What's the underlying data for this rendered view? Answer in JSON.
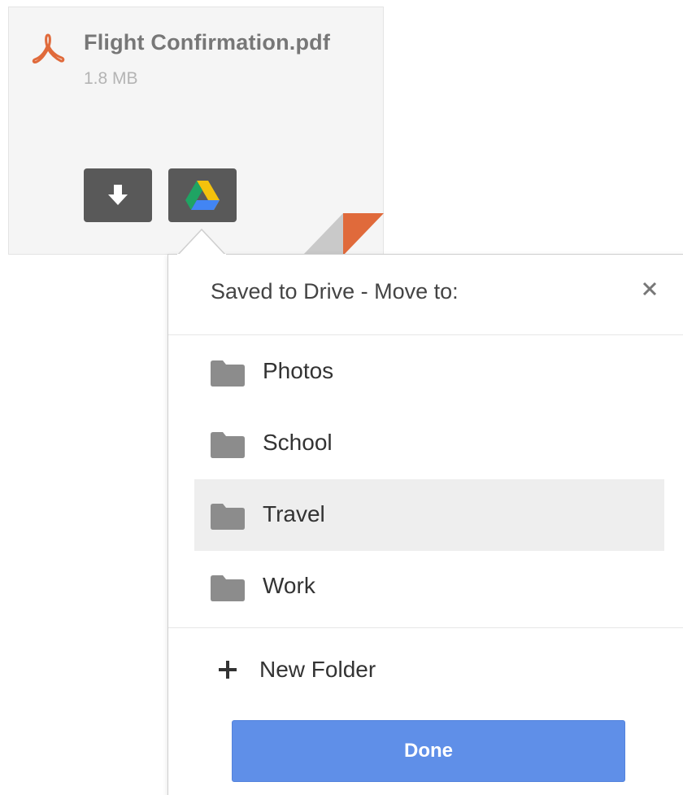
{
  "attachment": {
    "file_name": "Flight Confirmation.pdf",
    "file_size": "1.8 MB",
    "file_icon": "pdf-icon",
    "download_icon": "download-icon",
    "drive_icon": "google-drive-icon",
    "accent_color": "#e06a3b"
  },
  "popup": {
    "title": "Saved to Drive - Move to:",
    "close_icon": "close-icon",
    "folders": [
      {
        "label": "Photos",
        "selected": false
      },
      {
        "label": "School",
        "selected": false
      },
      {
        "label": "Travel",
        "selected": true
      },
      {
        "label": "Work",
        "selected": false
      }
    ],
    "new_folder_label": "New Folder",
    "done_label": "Done",
    "done_color": "#5f8fe8"
  }
}
